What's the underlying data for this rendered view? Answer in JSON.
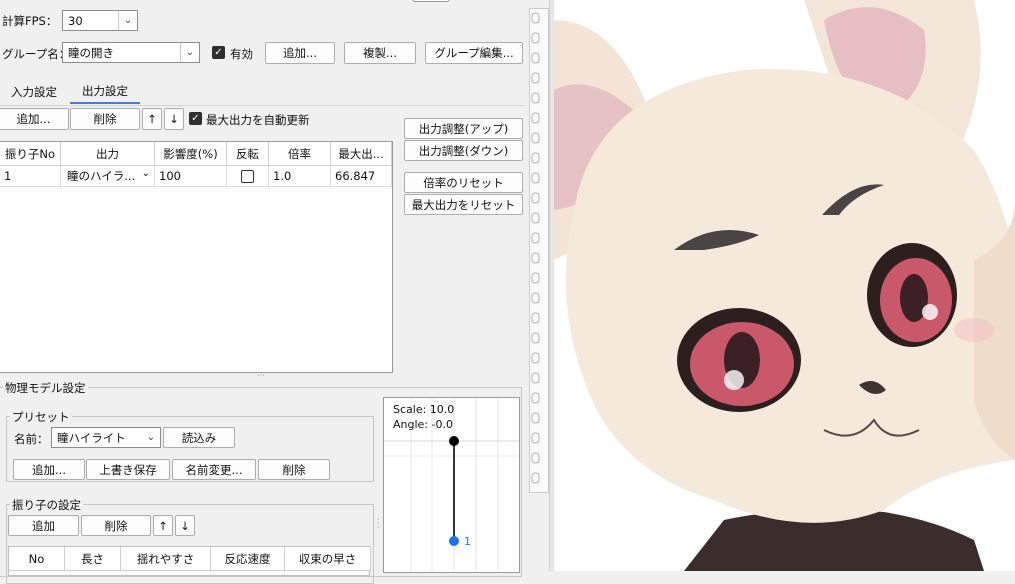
{
  "fps": {
    "label": "計算FPS：",
    "value": "30"
  },
  "group": {
    "label": "グループ名：",
    "value": "瞳の開き",
    "enabled_label": "有効",
    "enabled_checked": true,
    "add_label": "追加...",
    "duplicate_label": "複製...",
    "edit_label": "グループ編集..."
  },
  "tabs": [
    {
      "label": "入力設定",
      "active": false
    },
    {
      "label": "出力設定",
      "active": true
    }
  ],
  "output_toolbar": {
    "add_label": "追加...",
    "delete_label": "削除",
    "up_label": "↑",
    "down_label": "↓",
    "auto_update_label": "最大出力を自動更新",
    "auto_update_checked": true
  },
  "output_table": {
    "columns": [
      "振り子No",
      "出力",
      "影響度(%)",
      "反転",
      "倍率",
      "最大出..."
    ],
    "rows": [
      {
        "no": "1",
        "output": "瞳のハイラ...",
        "influence": "100",
        "invert": false,
        "scale": "1.0",
        "max": "66.847"
      }
    ]
  },
  "side_buttons": {
    "adjust_up": "出力調整(アップ)",
    "adjust_down": "出力調整(ダウン)",
    "reset_scale": "倍率のリセット",
    "reset_max": "最大出力をリセット"
  },
  "physics": {
    "title": "物理モデル設定",
    "preset": {
      "title": "プリセット",
      "name_label": "名前：",
      "name_value": "瞳ハイライト",
      "load_label": "読込み",
      "add_label": "追加...",
      "overwrite_label": "上書き保存",
      "rename_label": "名前変更...",
      "delete_label": "削除"
    },
    "pendulum": {
      "title": "振り子の設定",
      "add_label": "追加",
      "delete_label": "削除",
      "up_label": "↑",
      "down_label": "↓",
      "columns": [
        "No",
        "長さ",
        "揺れやすさ",
        "反応速度",
        "収束の早さ"
      ]
    }
  },
  "preview": {
    "scale_text": "Scale: 10.0",
    "angle_text": "Angle: -0.0",
    "node_label": "1"
  }
}
